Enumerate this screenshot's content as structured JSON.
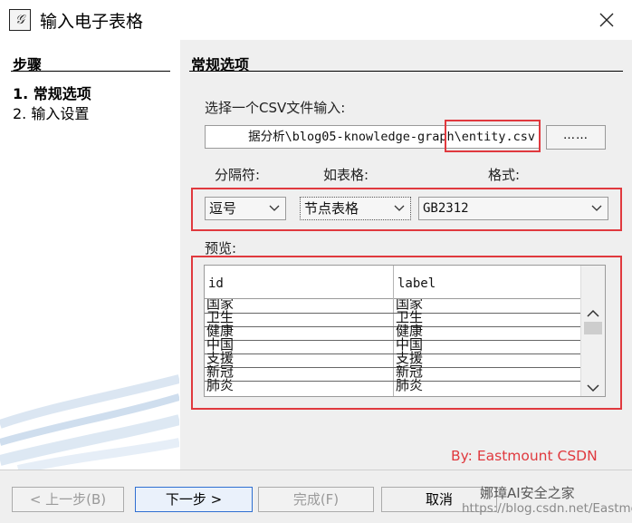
{
  "window": {
    "title": "输入电子表格",
    "icon": "app-logo-icon"
  },
  "steps": {
    "heading": "步骤",
    "items": [
      {
        "label": "1. 常规选项",
        "active": true
      },
      {
        "label": "2. 输入设置",
        "active": false
      }
    ]
  },
  "section": {
    "heading": "常规选项",
    "file_label": "选择一个CSV文件输入:",
    "file_path": "据分析\\blog05-knowledge-graph\\entity.csv",
    "browse_label": "……",
    "separator_label": "分隔符:",
    "table_label": "如表格:",
    "format_label": "格式:",
    "separator_value": "逗号",
    "table_value": "节点表格",
    "format_value": "GB2312",
    "preview_label": "预览:"
  },
  "preview": {
    "columns": [
      "id",
      "label"
    ],
    "rows": [
      [
        "国家",
        "国家"
      ],
      [
        "卫生",
        "卫生"
      ],
      [
        "健康",
        "健康"
      ],
      [
        "中国",
        "中国"
      ],
      [
        "支援",
        "支援"
      ],
      [
        "新冠",
        "新冠"
      ],
      [
        "肺炎",
        "肺炎"
      ]
    ]
  },
  "annotation": "By:  Eastmount CSDN",
  "buttons": {
    "back": "< 上一步(B)",
    "next": "下一步 >",
    "finish": "完成(F)",
    "cancel": "取消"
  },
  "watermark": {
    "name": "娜璋AI安全之家",
    "url": "https://blog.csdn.net/Eastmount"
  },
  "colors": {
    "highlight": "#e0393e",
    "pane": "#efefef"
  }
}
